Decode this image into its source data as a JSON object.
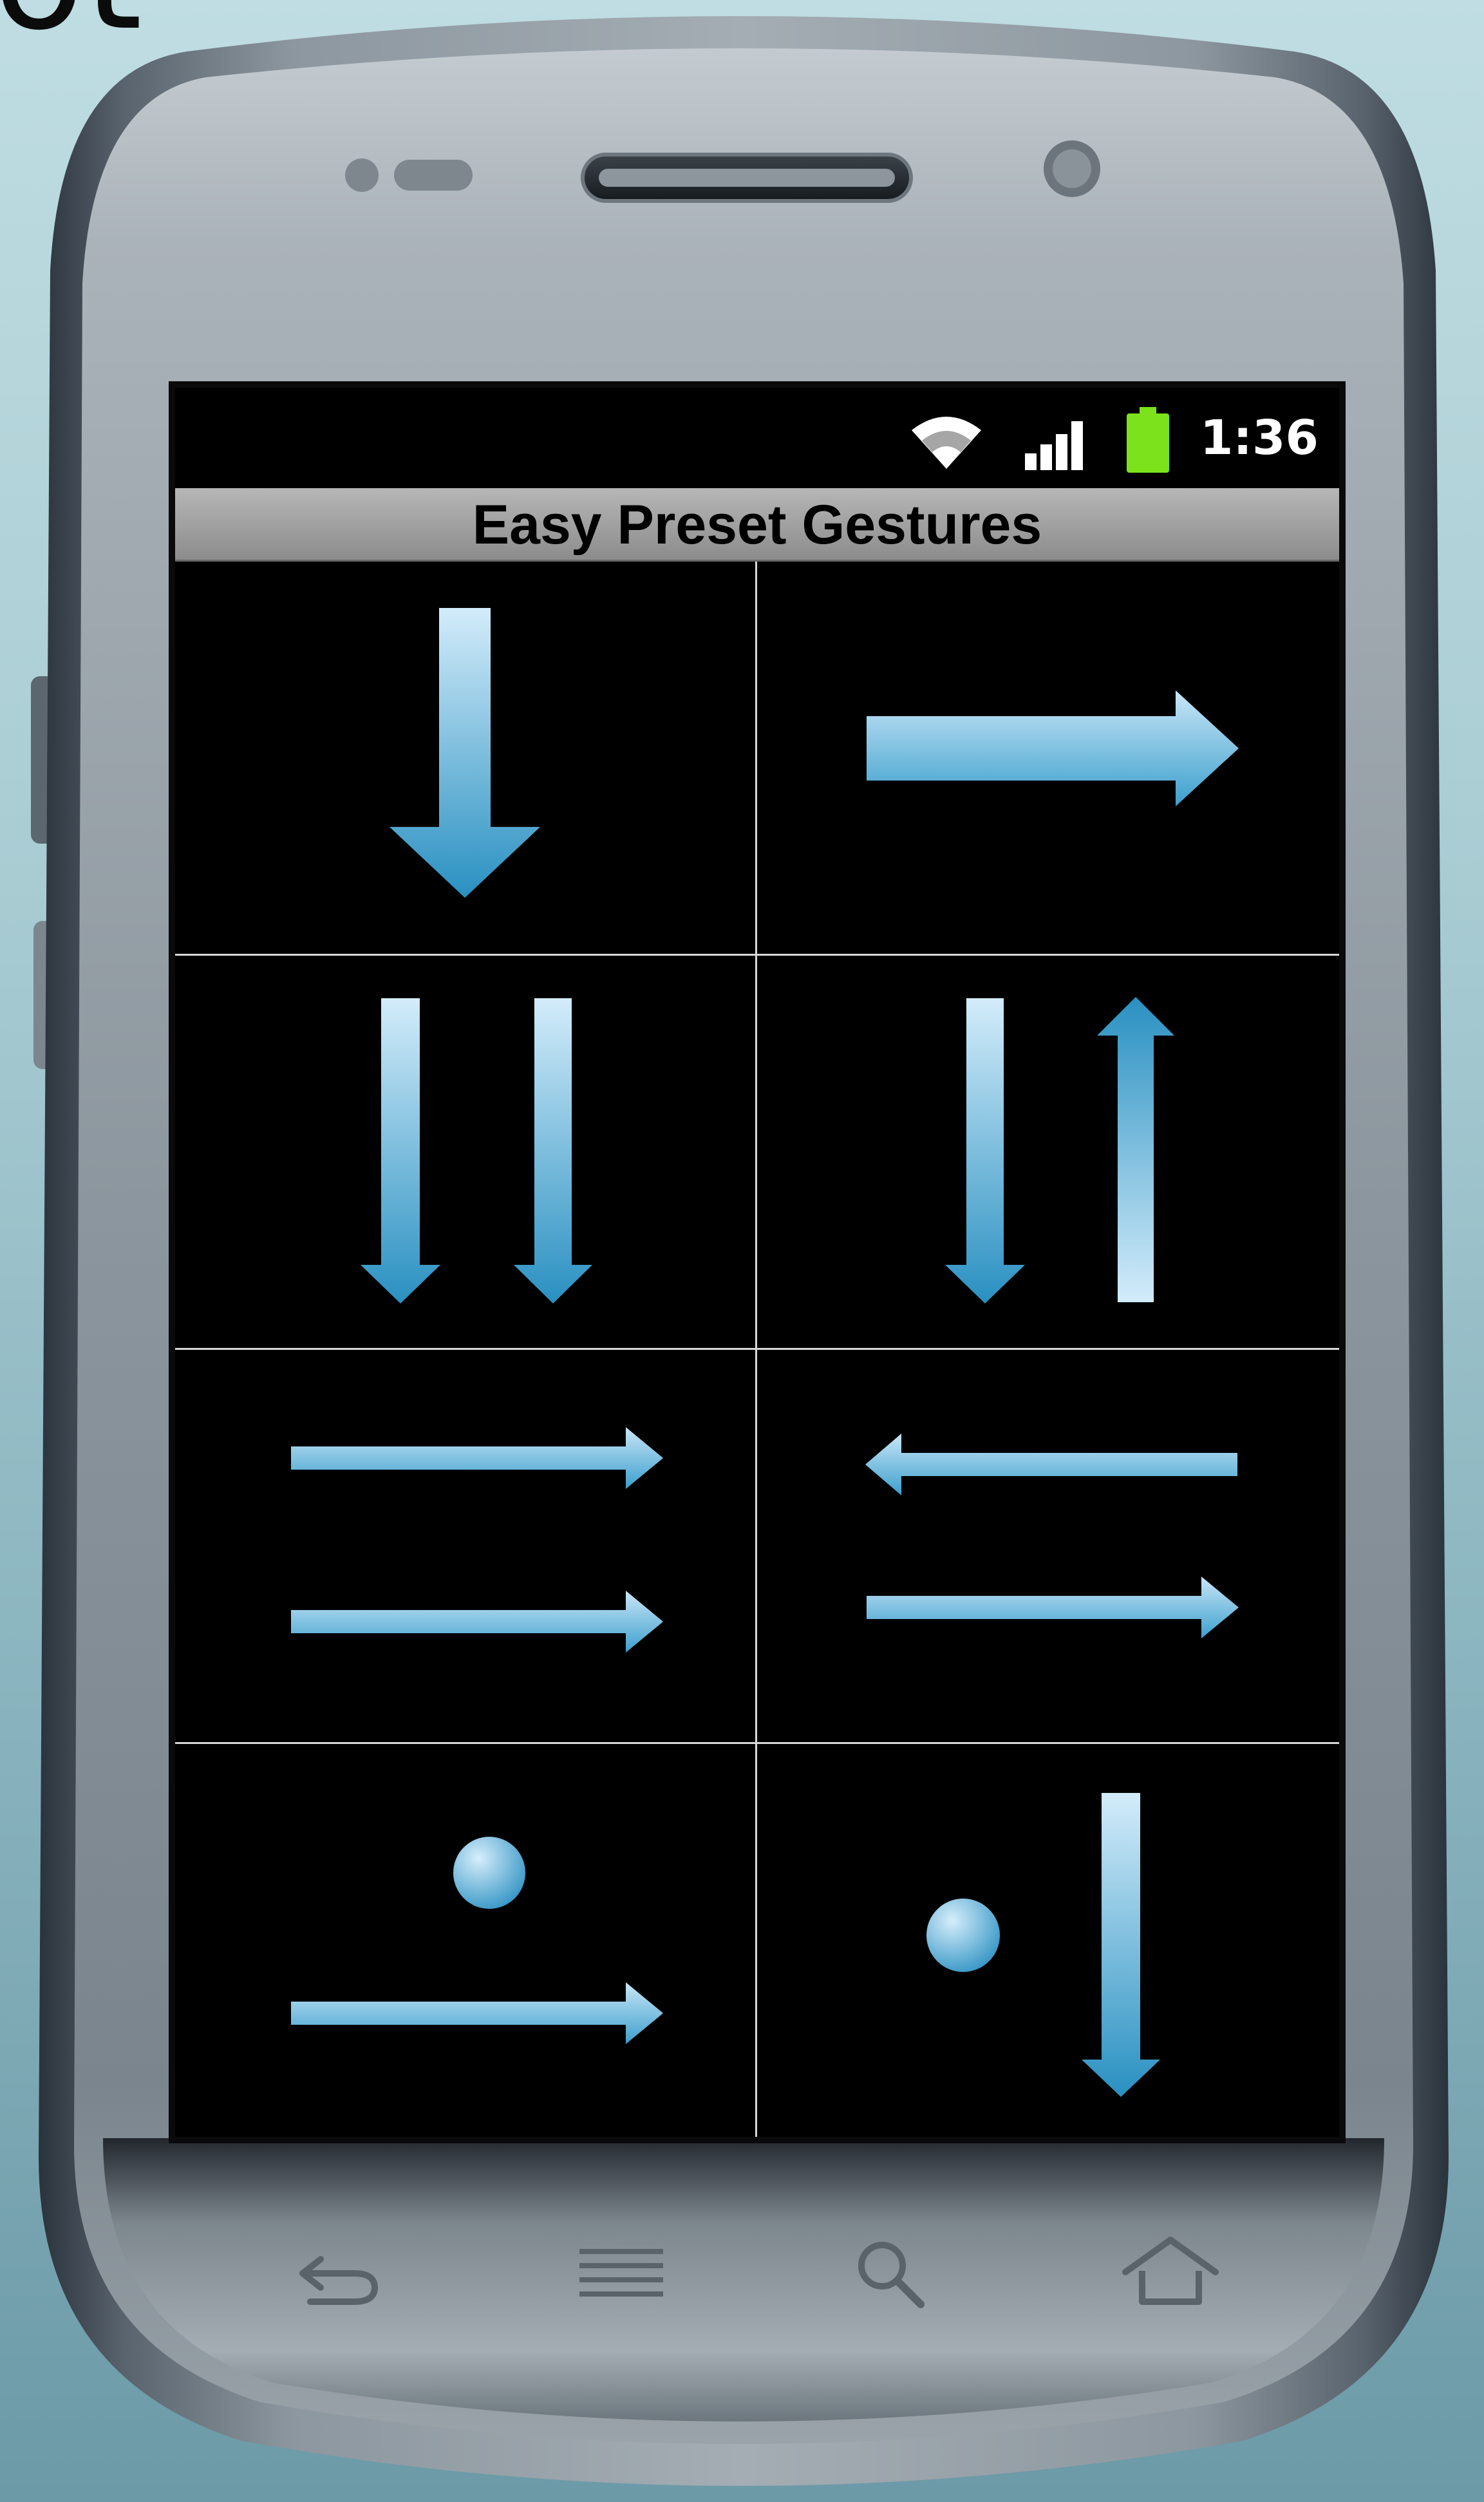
{
  "partial_header_text": "ot",
  "status_bar": {
    "time": "1:36",
    "icons": [
      "wifi-icon",
      "signal-icon",
      "battery-icon"
    ],
    "battery_color": "#7ce21c"
  },
  "app": {
    "title": "Easy Preset Gestures"
  },
  "gestures": [
    {
      "name": "swipe-down-icon"
    },
    {
      "name": "swipe-right-icon"
    },
    {
      "name": "two-finger-swipe-down-icon"
    },
    {
      "name": "swipe-down-and-up-icon"
    },
    {
      "name": "two-finger-swipe-right-icon"
    },
    {
      "name": "swipe-left-and-right-icon"
    },
    {
      "name": "hold-and-swipe-right-icon"
    },
    {
      "name": "hold-and-swipe-down-icon"
    }
  ],
  "colors": {
    "arrow_light": "#cfeaf9",
    "arrow_dark": "#2b93c3",
    "grid_lines": "#d8d8d8"
  },
  "nav_buttons": [
    "back-icon",
    "menu-icon",
    "search-icon",
    "home-icon"
  ]
}
